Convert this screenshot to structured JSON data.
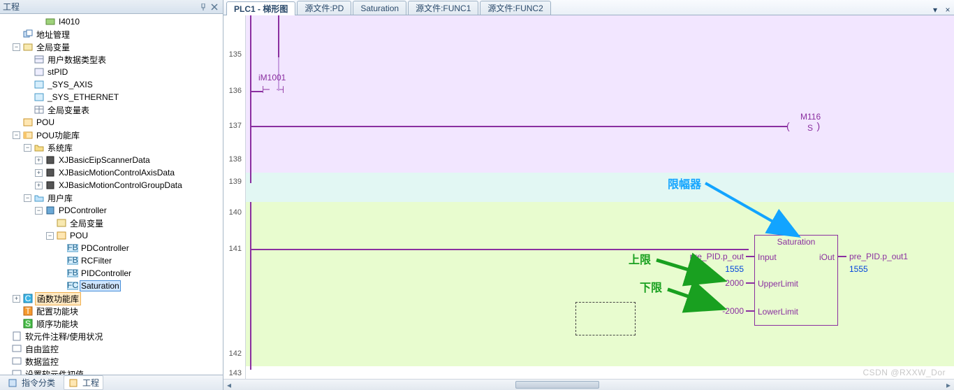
{
  "panel": {
    "title": "工程",
    "pin_icon": "pin-icon",
    "close_icon": "close-icon"
  },
  "footer_tabs": {
    "cmd": "指令分类",
    "proj": "工程"
  },
  "tree": {
    "i4010": "I4010",
    "addr": "地址管理",
    "globals": "全局变量",
    "userdt": "用户数据类型表",
    "stPID": "stPID",
    "sys_axis": "_SYS_AXIS",
    "sys_eth": "_SYS_ETHERNET",
    "globtable": "全局变量表",
    "pou": "POU",
    "poulib": "POU功能库",
    "syslib": "系统库",
    "eip": "XJBasicEipScannerData",
    "mca": "XJBasicMotionControlAxisData",
    "mcg": "XJBasicMotionControlGroupData",
    "userlib": "用户库",
    "pdctrl": "PDController",
    "glob2": "全局变量",
    "pou2": "POU",
    "pd": "PDController",
    "rcf": "RCFilter",
    "pidc": "PIDController",
    "sat": "Saturation",
    "funcblk": "函数功能库",
    "cfgblk": "配置功能块",
    "seqblk": "顺序功能块",
    "comment": "软元件注释/使用状况",
    "freemon": "自由监控",
    "datamon": "数据监控",
    "initval": "设置软元件初值"
  },
  "tabs": {
    "t1": "PLC1 - 梯形图",
    "t2": "源文件:PD",
    "t3": "Saturation",
    "t4": "源文件:FUNC1",
    "t5": "源文件:FUNC2"
  },
  "rungs": {
    "r135": "135",
    "r136": "136",
    "r137": "137",
    "r138": "138",
    "r139": "139",
    "r140": "140",
    "r141": "141",
    "r142": "142",
    "r143": "143"
  },
  "ladder": {
    "contact_dev": "iM1001",
    "coil_dev": "M116",
    "coil_set": "S",
    "input_var": "pre_PID.p_out",
    "input_val": "1555",
    "upper_val": "2000",
    "lower_val": "-2000",
    "out_var": "pre_PID.p_out1",
    "out_val": "1555"
  },
  "fb": {
    "title": "Saturation",
    "in": "Input",
    "out": "iOut",
    "ul": "UpperLimit",
    "ll": "LowerLimit"
  },
  "anno": {
    "limiter": "限幅器",
    "upper": "上限",
    "lower": "下限"
  },
  "watermark": "CSDN @RXXW_Dor"
}
